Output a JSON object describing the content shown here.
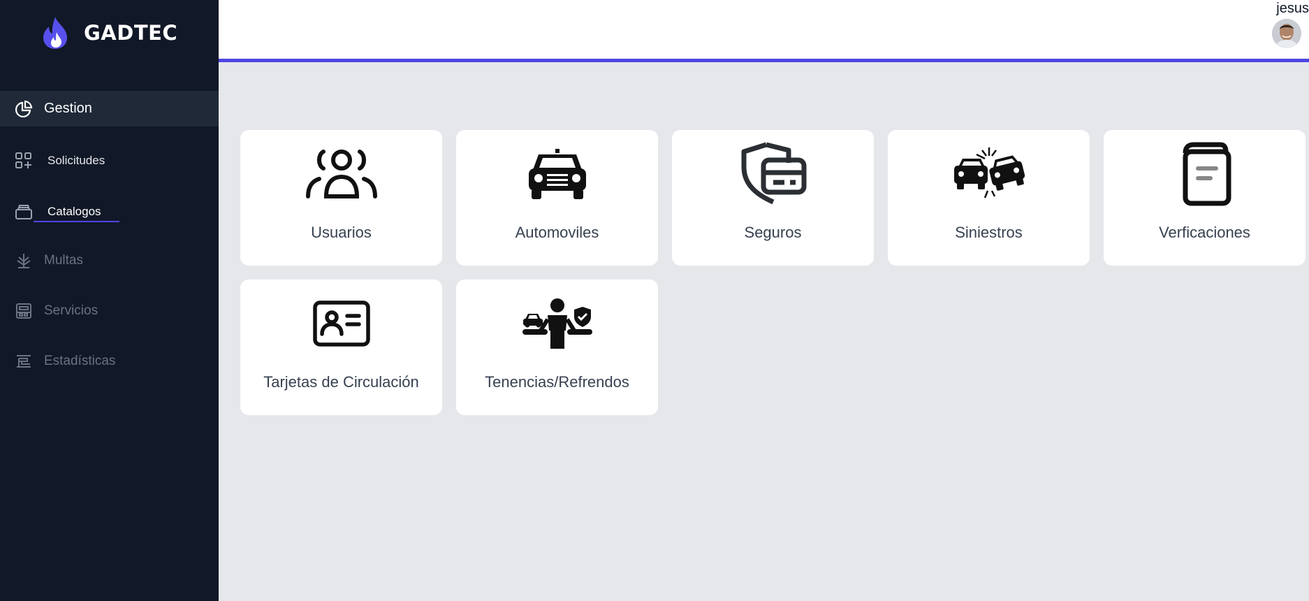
{
  "brand": {
    "name": "GADTEC"
  },
  "sidebar": {
    "items": [
      {
        "label": "Gestion",
        "icon": "pie-chart-icon"
      },
      {
        "label": "Solicitudes",
        "icon": "grid-add-icon"
      },
      {
        "label": "Catalogos",
        "icon": "archive-icon"
      },
      {
        "label": "Multas",
        "icon": "tree-icon"
      },
      {
        "label": "Servicios",
        "icon": "cash-register-icon"
      },
      {
        "label": "Estadísticas",
        "icon": "chart-bars-icon"
      }
    ]
  },
  "header": {
    "user_name": "jesus",
    "accent": "#4f46e5"
  },
  "catalogs": [
    {
      "label": "Usuarios",
      "icon": "users-icon"
    },
    {
      "label": "Automoviles",
      "icon": "car-icon"
    },
    {
      "label": "Seguros",
      "icon": "insurance-card-icon"
    },
    {
      "label": "Siniestros",
      "icon": "car-crash-icon"
    },
    {
      "label": "Verficaciones",
      "icon": "book-icon"
    },
    {
      "label": "Tarjetas de Circulación",
      "icon": "id-card-icon"
    },
    {
      "label": "Tenencias/Refrendos",
      "icon": "person-balance-icon"
    }
  ]
}
